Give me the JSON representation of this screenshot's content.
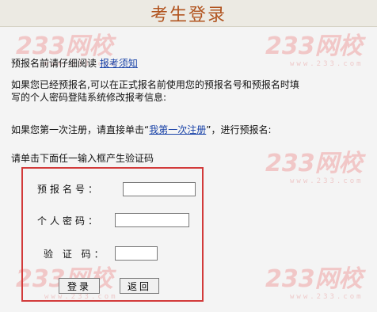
{
  "header": {
    "title": "考生登录"
  },
  "watermark": {
    "brand": "233网校",
    "sub": "www.233.com"
  },
  "intro": {
    "notice_prefix": "预报名前请仔细阅读",
    "notice_link": "报考须知",
    "para1_line1": "如果您已经预报名,可以在正式报名前使用您的预报名号和预报名时填",
    "para1_line2": "写的个人密码登陆系统修改报考信息:",
    "first_time_prefix": "如果您第一次注册，请直接单击“",
    "first_time_link": "我第一次注册",
    "first_time_suffix": "”，进行预报名:",
    "captcha_hint": "请单击下面任一输入框产生验证码"
  },
  "form": {
    "prereg_label": "预报名号：",
    "password_label": "个人密码：",
    "captcha_label": "验 证 码：",
    "prereg_value": "",
    "password_value": "",
    "captcha_value": "",
    "login_label": "登录",
    "back_label": "返回"
  },
  "colors": {
    "title": "#b1541f",
    "highlight_border": "#d23a3a",
    "link": "#1a43a8"
  }
}
